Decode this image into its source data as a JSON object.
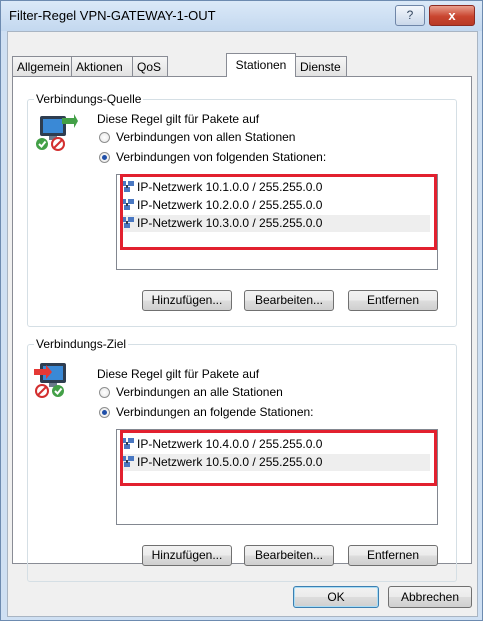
{
  "window": {
    "title": "Filter-Regel VPN-GATEWAY-1-OUT",
    "help_glyph": "?",
    "close_glyph": "x"
  },
  "tabs": [
    {
      "label": "Allgemein"
    },
    {
      "label": "Aktionen"
    },
    {
      "label": "QoS"
    },
    {
      "label": "Stationen",
      "active": true
    },
    {
      "label": "Dienste"
    }
  ],
  "source": {
    "group_label": "Verbindungs-Quelle",
    "description": "Diese Regel gilt für Pakete auf",
    "option_all": "Verbindungen von allen Stationen",
    "option_following": "Verbindungen von folgenden Stationen:",
    "selected_option": "following",
    "items": [
      "IP-Netzwerk 10.1.0.0 / 255.255.0.0",
      "IP-Netzwerk 10.2.0.0 / 255.255.0.0",
      "IP-Netzwerk 10.3.0.0 / 255.255.0.0"
    ],
    "add_label": "Hinzufügen...",
    "edit_label": "Bearbeiten...",
    "remove_label": "Entfernen"
  },
  "destination": {
    "group_label": "Verbindungs-Ziel",
    "description": "Diese Regel gilt für Pakete auf",
    "option_all": "Verbindungen an alle Stationen",
    "option_following": "Verbindungen an folgende Stationen:",
    "selected_option": "following",
    "items": [
      "IP-Netzwerk 10.4.0.0 / 255.255.0.0",
      "IP-Netzwerk 10.5.0.0 / 255.255.0.0"
    ],
    "add_label": "Hinzufügen...",
    "edit_label": "Bearbeiten...",
    "remove_label": "Entfernen"
  },
  "footer": {
    "ok_label": "OK",
    "cancel_label": "Abbrechen"
  },
  "colors": {
    "highlight": "#e2202f",
    "window_frame": "#cfe0f3"
  },
  "icons": {
    "source": "network-source-icon",
    "destination": "network-destination-icon",
    "list_item": "ip-network-icon"
  }
}
